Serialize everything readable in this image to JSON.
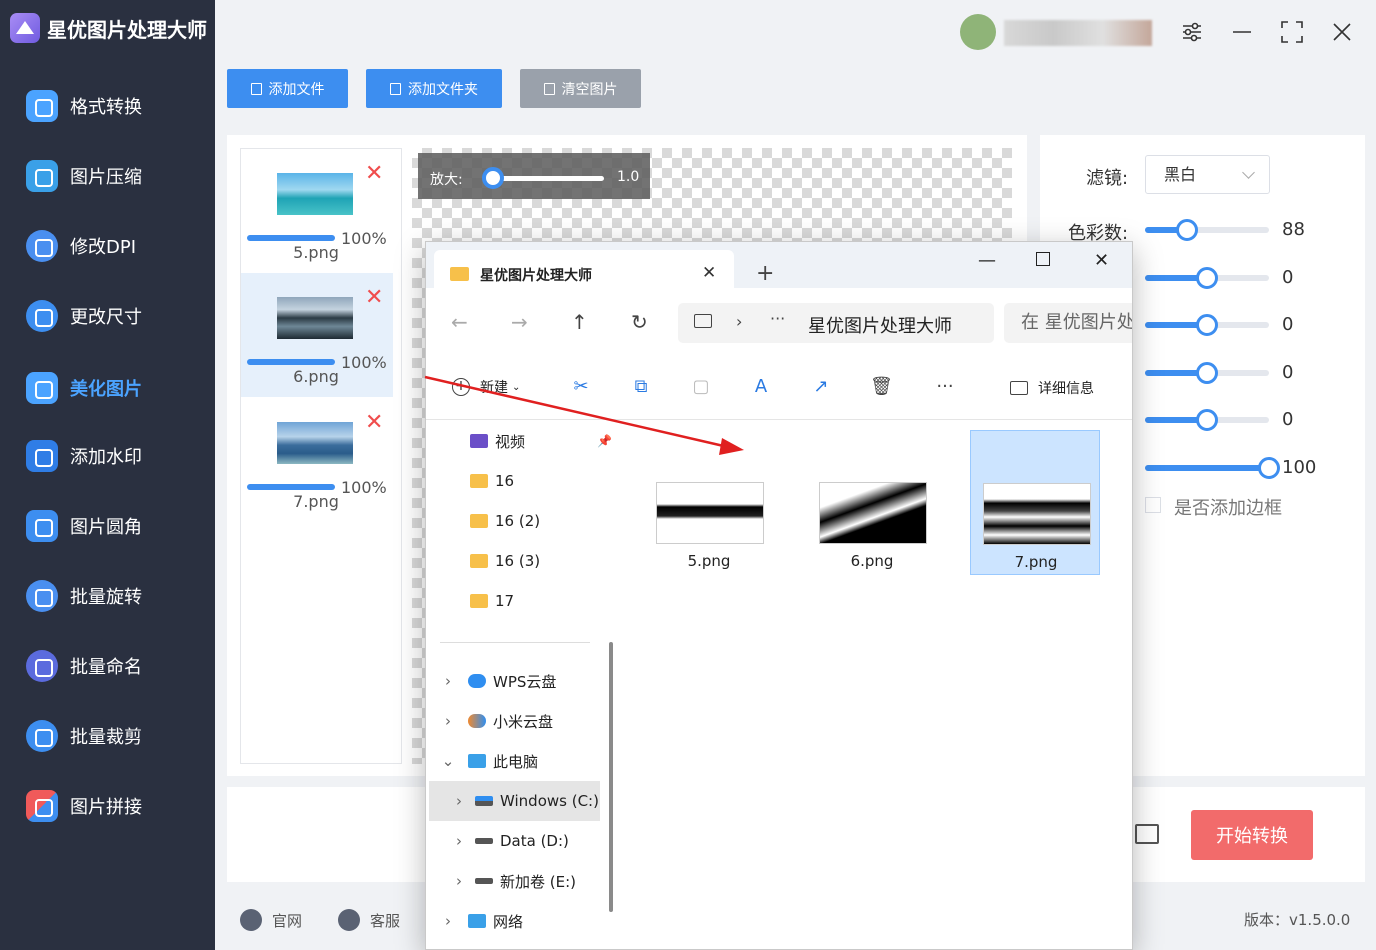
{
  "app": {
    "title": "星优图片处理大师",
    "version": "版本：v1.5.0.0"
  },
  "sidebar": {
    "items": [
      {
        "label": "格式转换",
        "icon": "format-convert-icon",
        "color": "#4ba3ff"
      },
      {
        "label": "图片压缩",
        "icon": "image-compress-icon",
        "color": "#3aa0e8"
      },
      {
        "label": "修改DPI",
        "icon": "dpi-icon",
        "color": "#4a8ff0"
      },
      {
        "label": "更改尺寸",
        "icon": "resize-icon",
        "color": "#3d8ef0"
      },
      {
        "label": "美化图片",
        "icon": "beautify-icon",
        "color": "#4ba3ff",
        "active": true
      },
      {
        "label": "添加水印",
        "icon": "watermark-icon",
        "color": "#2f7de6"
      },
      {
        "label": "图片圆角",
        "icon": "round-corner-icon",
        "color": "#3d8ef0"
      },
      {
        "label": "批量旋转",
        "icon": "rotate-icon",
        "color": "#4a8ff0"
      },
      {
        "label": "批量命名",
        "icon": "rename-icon",
        "color": "#5b6bde"
      },
      {
        "label": "批量裁剪",
        "icon": "crop-icon",
        "color": "#3d8ef0"
      },
      {
        "label": "图片拼接",
        "icon": "puzzle-icon",
        "color": "#3d8ef0"
      }
    ]
  },
  "toolbar": {
    "add_file": "添加文件",
    "add_folder": "添加文件夹",
    "clear": "清空图片"
  },
  "thumbnails": [
    {
      "name": "5.png",
      "progress": "100%",
      "progress_value": 1.0
    },
    {
      "name": "6.png",
      "progress": "100%",
      "progress_value": 1.0
    },
    {
      "name": "7.png",
      "progress": "100%",
      "progress_value": 1.0
    }
  ],
  "preview": {
    "zoom_label": "放大:",
    "zoom_value": "1.0"
  },
  "settings": {
    "filter_label": "滤镜:",
    "filter_value": "黑白",
    "color_count_label": "色彩数:",
    "sliders": [
      {
        "value": "88",
        "fraction": 0.34
      },
      {
        "value": "0",
        "fraction": 0.5
      },
      {
        "value": "0",
        "fraction": 0.5
      },
      {
        "value": "0",
        "fraction": 0.5
      },
      {
        "value": "0",
        "fraction": 0.5
      },
      {
        "value": "100",
        "fraction": 1.0
      }
    ],
    "border_label": "是否添加边框"
  },
  "actions": {
    "start": "开始转换"
  },
  "footer": {
    "website": "官网",
    "support": "客服"
  },
  "explorer": {
    "tab_title": "星优图片处理大师",
    "address": "星优图片处理大师",
    "search_placeholder": "在 星优图片处",
    "new_label": "新建",
    "details_label": "详细信息",
    "tree": [
      {
        "label": "视频",
        "icon": "video-folder-icon",
        "pinned": true
      },
      {
        "label": "16",
        "icon": "folder-icon"
      },
      {
        "label": "16 (2)",
        "icon": "folder-icon"
      },
      {
        "label": "16 (3)",
        "icon": "folder-icon"
      },
      {
        "label": "17",
        "icon": "folder-icon"
      },
      {
        "label": "WPS云盘",
        "icon": "cloud-icon"
      },
      {
        "label": "小米云盘",
        "icon": "cloud-icon"
      },
      {
        "label": "此电脑",
        "icon": "computer-icon"
      },
      {
        "label": "Windows (C:)",
        "icon": "drive-icon"
      },
      {
        "label": "Data (D:)",
        "icon": "drive-icon"
      },
      {
        "label": "新加卷 (E:)",
        "icon": "drive-icon"
      },
      {
        "label": "网络",
        "icon": "network-icon"
      }
    ],
    "files": [
      {
        "name": "5.png"
      },
      {
        "name": "6.png"
      },
      {
        "name": "7.png",
        "selected": true
      }
    ]
  },
  "colors": {
    "sidebar_bg": "#2a3040",
    "accent": "#3d8ef0",
    "start_button": "#f26b6b",
    "delete_red": "#f04d4d"
  }
}
